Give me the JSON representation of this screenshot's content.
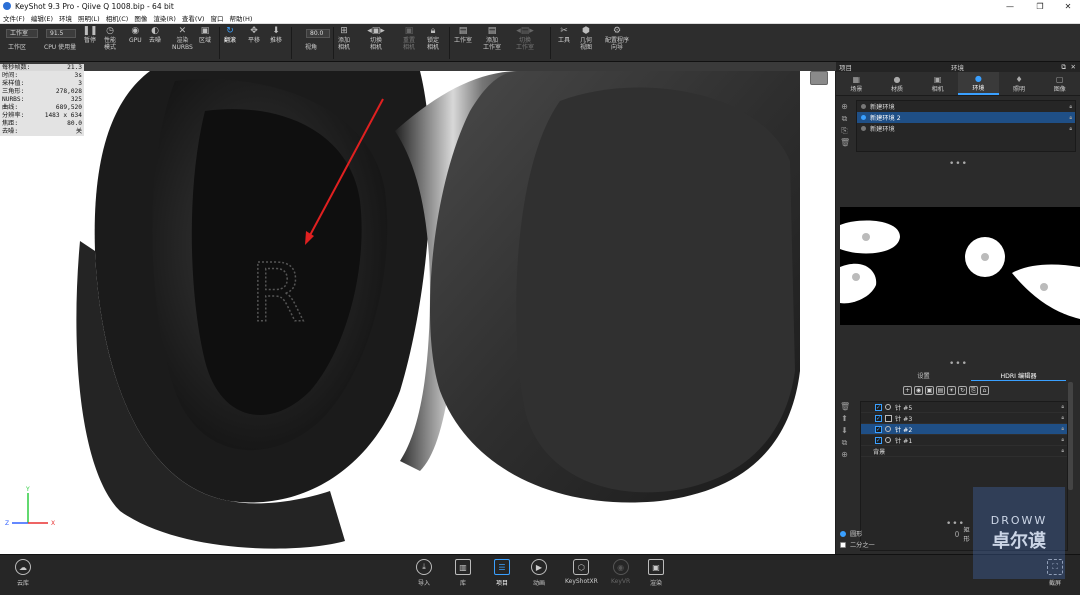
{
  "window": {
    "title": "KeyShot 9.3 Pro  - Qiive Q 1008.bip  - 64 bit"
  },
  "menu": [
    "文件(F)",
    "编辑(E)",
    "环境",
    "照明(L)",
    "相机(C)",
    "图像",
    "渲染(R)",
    "查看(V)",
    "窗口",
    "帮助(H)"
  ],
  "toolbar": {
    "workspace_select": "工作室",
    "workspace_label": "工作区",
    "cpu_value": "91.5",
    "cpu_label": "CPU 使用量",
    "pause": "暂停",
    "perf_mode": "性能\n模式",
    "gpu": "GPU",
    "denoise": "去噪",
    "render_nurbs": "渲染\nNURBS",
    "region": "区域",
    "rotate": "翻滚",
    "pan": "平移",
    "dolly": "推移",
    "fov_value": "80.0",
    "fov_label": "视角",
    "add_camera": "添加\n相机",
    "switch_camera": "切换\n相机",
    "reset_camera": "重置\n相机",
    "lock_camera": "锁定\n相机",
    "studio": "工作室",
    "add_studio": "添加\n工作室",
    "switch_studio": "切换\n工作室",
    "tools": "工具",
    "geometry_view": "几何\n视图",
    "config_wizard": "配置程序\n向导"
  },
  "stats": [
    {
      "k": "每秒帧数:",
      "v": "21.3"
    },
    {
      "k": "时间:",
      "v": "3s"
    },
    {
      "k": "采样值:",
      "v": "3"
    },
    {
      "k": "三角形:",
      "v": "278,028"
    },
    {
      "k": "NURBS:",
      "v": "325"
    },
    {
      "k": "曲线:",
      "v": "689,520"
    },
    {
      "k": "分辨率:",
      "v": "1483 x 634"
    },
    {
      "k": "焦距:",
      "v": "80.0"
    },
    {
      "k": "去噪:",
      "v": "关"
    }
  ],
  "panel": {
    "header_left": "项目",
    "header_center": "环境",
    "tabs": [
      {
        "label": "场景",
        "icon": "scene-icon"
      },
      {
        "label": "材质",
        "icon": "material-icon"
      },
      {
        "label": "相机",
        "icon": "camera-icon"
      },
      {
        "label": "环境",
        "icon": "environment-icon"
      },
      {
        "label": "照明",
        "icon": "lighting-icon"
      },
      {
        "label": "图像",
        "icon": "image-icon"
      }
    ],
    "environments": [
      "新建环境",
      "新建环境 2",
      "新建环境"
    ],
    "subtabs": [
      "设置",
      "HDRI 编辑器"
    ],
    "pins": [
      "针 #5",
      "针 #3",
      "针 #2",
      "针 #1"
    ],
    "background_label": "背景",
    "shape_options": [
      "圆形",
      "矩形"
    ],
    "quarter_option": "二分之一"
  },
  "bottom": {
    "cloud": "云库",
    "import": "导入",
    "library": "库",
    "project": "项目",
    "animation": "动画",
    "keyshotxr": "KeyShotXR",
    "keyvr": "KeyVR",
    "render": "渲染",
    "screenshot": "截屏"
  },
  "watermark": {
    "en": "DROWW",
    "cn": "卓尔谟"
  },
  "axes": {
    "x": "X",
    "y": "Y",
    "z": "Z"
  }
}
